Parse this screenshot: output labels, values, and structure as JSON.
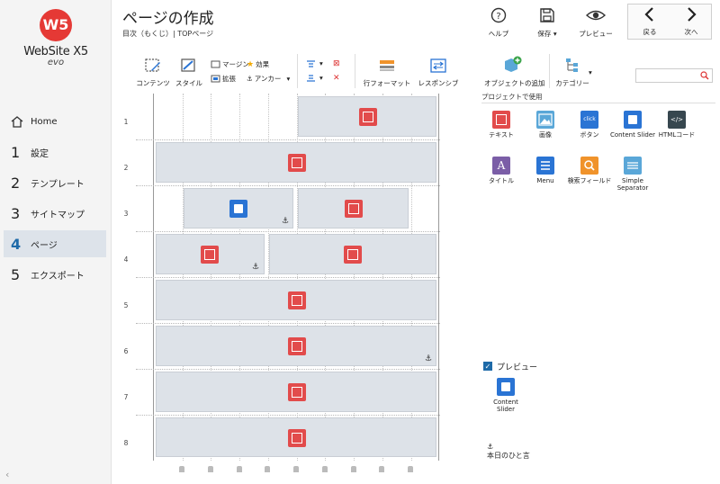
{
  "app": {
    "logo_mark": "W5",
    "logo_name": "WebSite X5",
    "logo_edition": "evo",
    "brand_color": "#e53935"
  },
  "sidebar": {
    "home_label": "Home",
    "items": [
      {
        "num": "1",
        "label": "設定"
      },
      {
        "num": "2",
        "label": "テンプレート"
      },
      {
        "num": "3",
        "label": "サイトマップ"
      },
      {
        "num": "4",
        "label": "ページ"
      },
      {
        "num": "5",
        "label": "エクスポート"
      }
    ],
    "collapse_glyph": "‹"
  },
  "header": {
    "title": "ページの作成",
    "breadcrumb": "目次（もくじ）| TOPページ",
    "help": "ヘルプ",
    "save": "保存",
    "preview": "プレビュー",
    "back": "戻る",
    "next": "次へ"
  },
  "toolbar": {
    "content": "コンテンツ",
    "style": "スタイル",
    "margin": "マージン",
    "effect": "効果",
    "extend": "拡張",
    "anchor": "アンカー",
    "row_format": "行フォーマット",
    "responsive": "レスポンシブ",
    "add_object": "オブジェクトの追加",
    "category": "カテゴリー"
  },
  "grid": {
    "rows": [
      "1",
      "2",
      "3",
      "4",
      "5",
      "6",
      "7",
      "8"
    ]
  },
  "objects": {
    "section_title": "プロジェクトで使用",
    "items": [
      {
        "label": "テキスト",
        "icon": "text-icon",
        "color": "#e24b4b"
      },
      {
        "label": "画像",
        "icon": "image-icon",
        "color": "#5aa7d8"
      },
      {
        "label": "ボタン",
        "icon": "button-icon",
        "color": "#2a74d4",
        "glyph": "click"
      },
      {
        "label": "Content Slider",
        "icon": "content-slider-icon",
        "color": "#2a74d4"
      },
      {
        "label": "HTMLコード",
        "icon": "html-code-icon",
        "color": "#37474f",
        "glyph": "</>"
      },
      {
        "label": "タイトル",
        "icon": "title-icon",
        "color": "#7b5ea7",
        "glyph": "A"
      },
      {
        "label": "Menu",
        "icon": "menu-icon",
        "color": "#2a74d4"
      },
      {
        "label": "検索フィールド",
        "icon": "search-field-icon",
        "color": "#f0932b"
      },
      {
        "label": "Simple Separator",
        "icon": "separator-icon",
        "color": "#5aa7d8"
      }
    ]
  },
  "preview_panel": {
    "label": "プレビュー",
    "object_label": "Content Slider",
    "anchor_text": "本日のひと言"
  }
}
